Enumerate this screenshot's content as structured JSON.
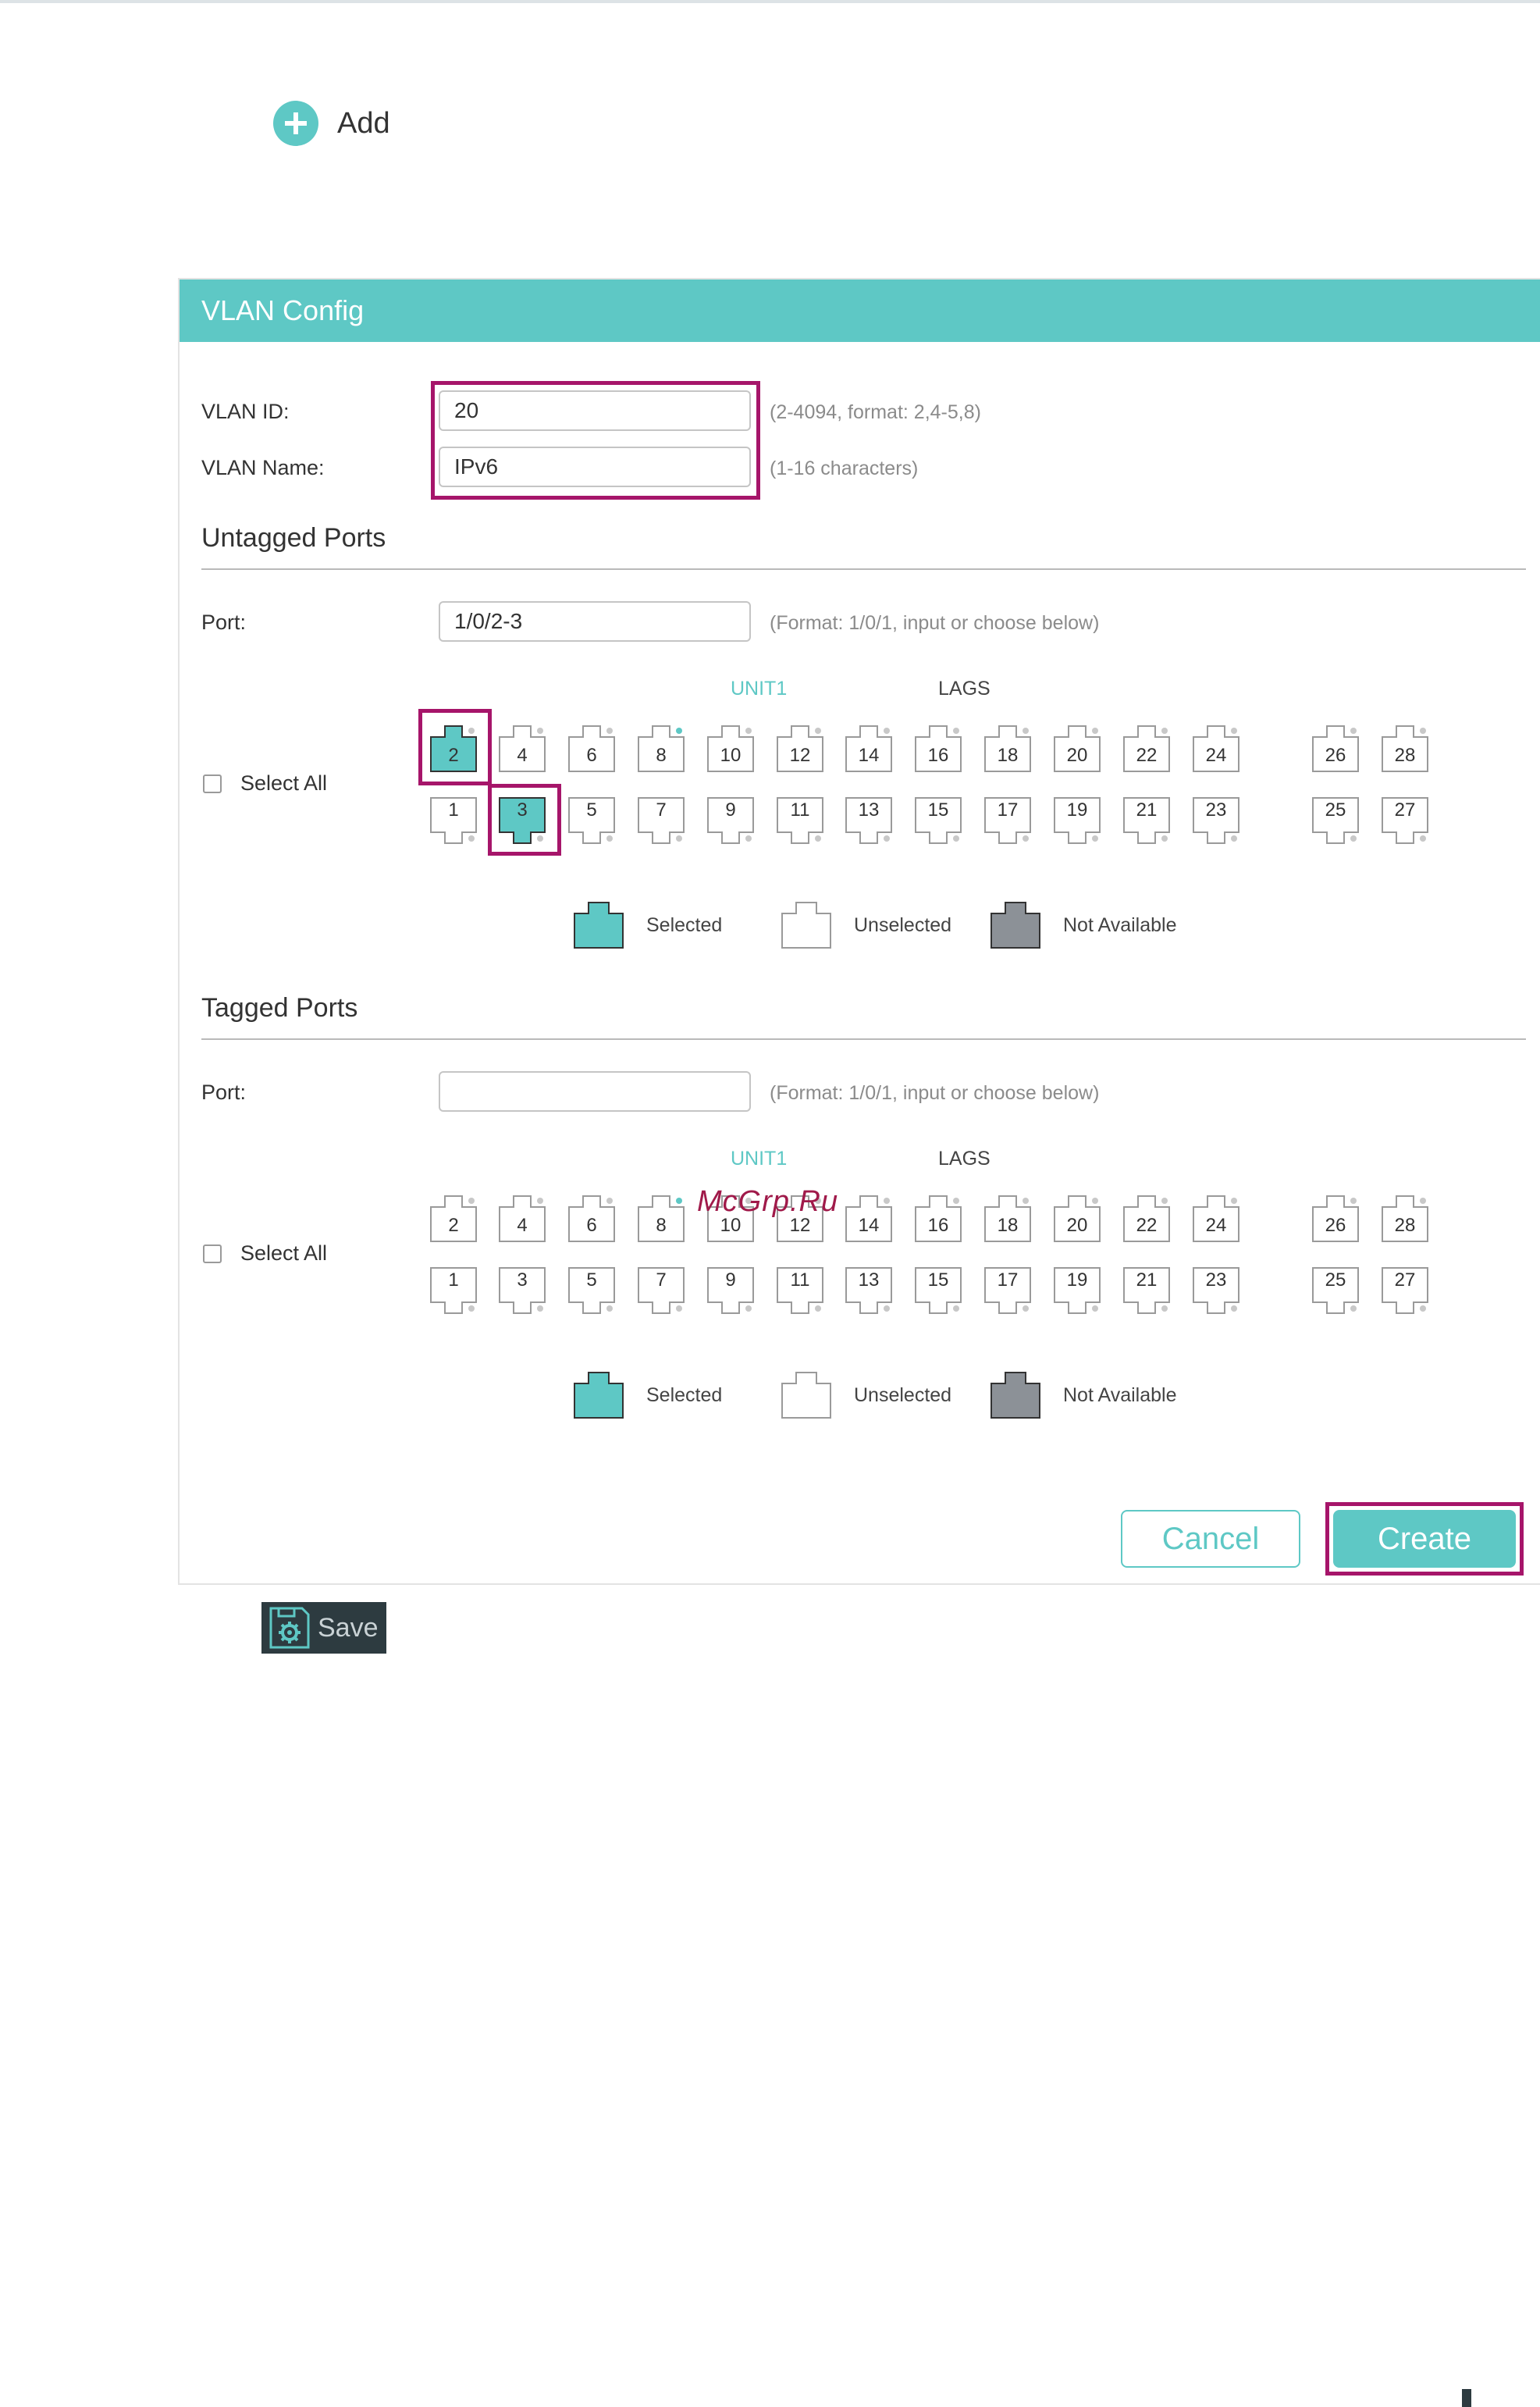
{
  "toolbar": {
    "add_label": "Add"
  },
  "panel": {
    "title": "VLAN Config"
  },
  "vlan_id": {
    "label": "VLAN ID:",
    "value": "20",
    "hint": "(2-4094, format: 2,4-5,8)"
  },
  "vlan_name": {
    "label": "VLAN Name:",
    "value": "IPv6",
    "hint": "(1-16 characters)"
  },
  "untagged": {
    "title": "Untagged Ports",
    "port_label": "Port:",
    "port_value": "1/0/2-3",
    "port_placeholder": "",
    "port_hint": "(Format: 1/0/1, input or choose below)",
    "unit_label": "UNIT1",
    "lags_label": "LAGS",
    "select_all": "Select All",
    "selected_ports": [
      "2",
      "3"
    ]
  },
  "tagged": {
    "title": "Tagged Ports",
    "port_label": "Port:",
    "port_value": "",
    "port_placeholder": "",
    "port_hint": "(Format: 1/0/1, input or choose below)",
    "unit_label": "UNIT1",
    "lags_label": "LAGS",
    "select_all": "Select All",
    "selected_ports": []
  },
  "ports": {
    "top_row": [
      "2",
      "4",
      "6",
      "8",
      "10",
      "12",
      "14",
      "16",
      "18",
      "20",
      "22",
      "24",
      "26",
      "28"
    ],
    "bottom_row": [
      "1",
      "3",
      "5",
      "7",
      "9",
      "11",
      "13",
      "15",
      "17",
      "19",
      "21",
      "23",
      "25",
      "27"
    ]
  },
  "legend": {
    "selected": "Selected",
    "unselected": "Unselected",
    "not_available": "Not Available"
  },
  "buttons": {
    "cancel": "Cancel",
    "create": "Create",
    "save": "Save"
  },
  "watermark": "McGrp.Ru",
  "colors": {
    "accent": "#5ec8c5",
    "highlight": "#a6156a",
    "not_available": "#8c9197",
    "save_bg": "#2d3b40",
    "port_indicator": "#5ec8c5"
  }
}
